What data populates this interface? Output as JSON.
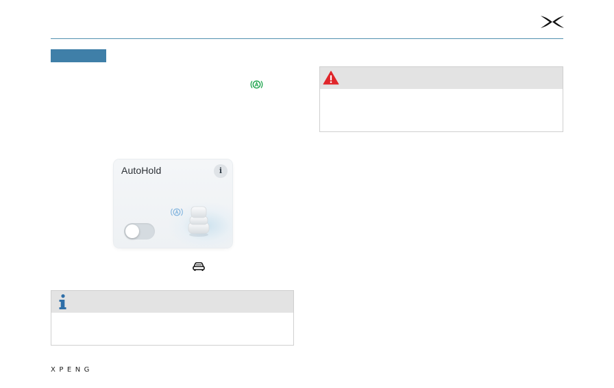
{
  "card": {
    "title": "AutoHold",
    "info_glyph": "i",
    "toggle_state": "off"
  },
  "footer": {
    "wordmark": "XPENG"
  },
  "icons": {
    "brand": "xpeng-x-logo-icon",
    "autohold_status": "autohold-a-icon",
    "car": "car-icon",
    "info": "info-icon",
    "warning": "warning-triangle-icon"
  },
  "colors": {
    "header_rule": "#4f8fae",
    "section_tag": "#3f7fa8",
    "autohold_green": "#1aa34a",
    "info_blue": "#2f6fa8",
    "warning_red": "#e0262b",
    "hold_indicator_blue": "#7fb3de"
  }
}
